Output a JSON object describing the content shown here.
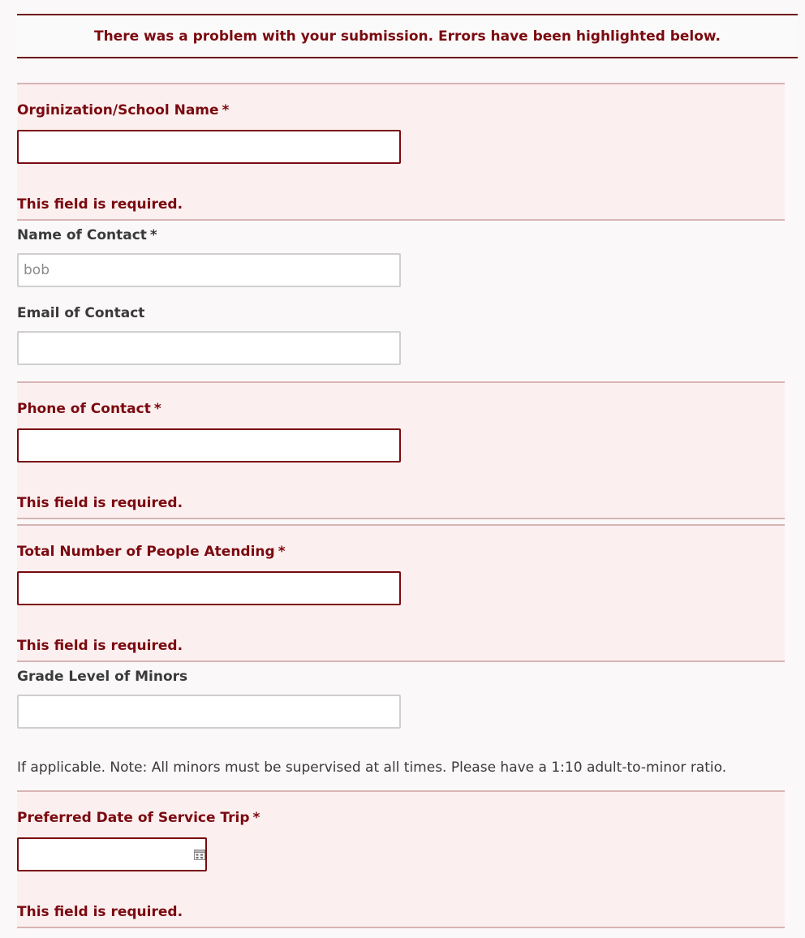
{
  "banner": {
    "text": "There was a problem with your submission. Errors have been highlighted below."
  },
  "fields": {
    "org": {
      "label": "Orginization/School Name",
      "required": "*",
      "value": "",
      "error": "This field is required."
    },
    "contact_name": {
      "label": "Name of Contact",
      "required": "*",
      "value": "bob"
    },
    "email": {
      "label": "Email of Contact",
      "value": ""
    },
    "phone": {
      "label": "Phone of Contact",
      "required": "*",
      "value": "",
      "error": "This field is required."
    },
    "total_people": {
      "label": "Total Number of People Atending",
      "required": "*",
      "value": "",
      "error": "This field is required."
    },
    "grade_level": {
      "label": "Grade Level of Minors",
      "value": "",
      "note": "If applicable. Note: All minors must be supervised at all times. Please have a 1:10 adult-to-minor ratio."
    },
    "date": {
      "label": "Preferred Date of Service Trip",
      "required": "*",
      "value": "",
      "error": "This field is required.",
      "icon": "calendar-icon"
    }
  },
  "colors": {
    "error_text": "#7a0a10",
    "error_bg": "#fcefef",
    "error_border": "#d8b4b4",
    "label_text": "#3a3a3a"
  }
}
